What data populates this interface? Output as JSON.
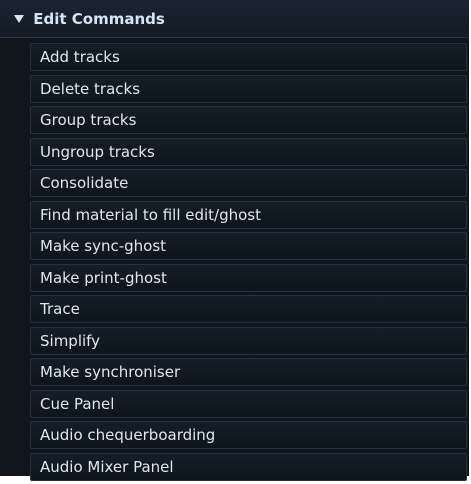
{
  "section": {
    "title": "Edit Commands",
    "expanded": true,
    "items": [
      {
        "label": "Add tracks"
      },
      {
        "label": "Delete tracks"
      },
      {
        "label": "Group tracks"
      },
      {
        "label": "Ungroup tracks"
      },
      {
        "label": "Consolidate"
      },
      {
        "label": "Find material to fill edit/ghost"
      },
      {
        "label": "Make sync-ghost"
      },
      {
        "label": "Make print-ghost"
      },
      {
        "label": "Trace"
      },
      {
        "label": "Simplify"
      },
      {
        "label": "Make synchroniser"
      },
      {
        "label": "Cue Panel"
      },
      {
        "label": "Audio chequerboarding"
      },
      {
        "label": "Audio Mixer Panel"
      }
    ]
  },
  "icons": {
    "header_toggle": "triangle-down-icon"
  },
  "colors": {
    "panel_background": "#11161c",
    "item_border": "#273240",
    "text": "#dfe6ee",
    "header_text": "#d7e4f4"
  }
}
